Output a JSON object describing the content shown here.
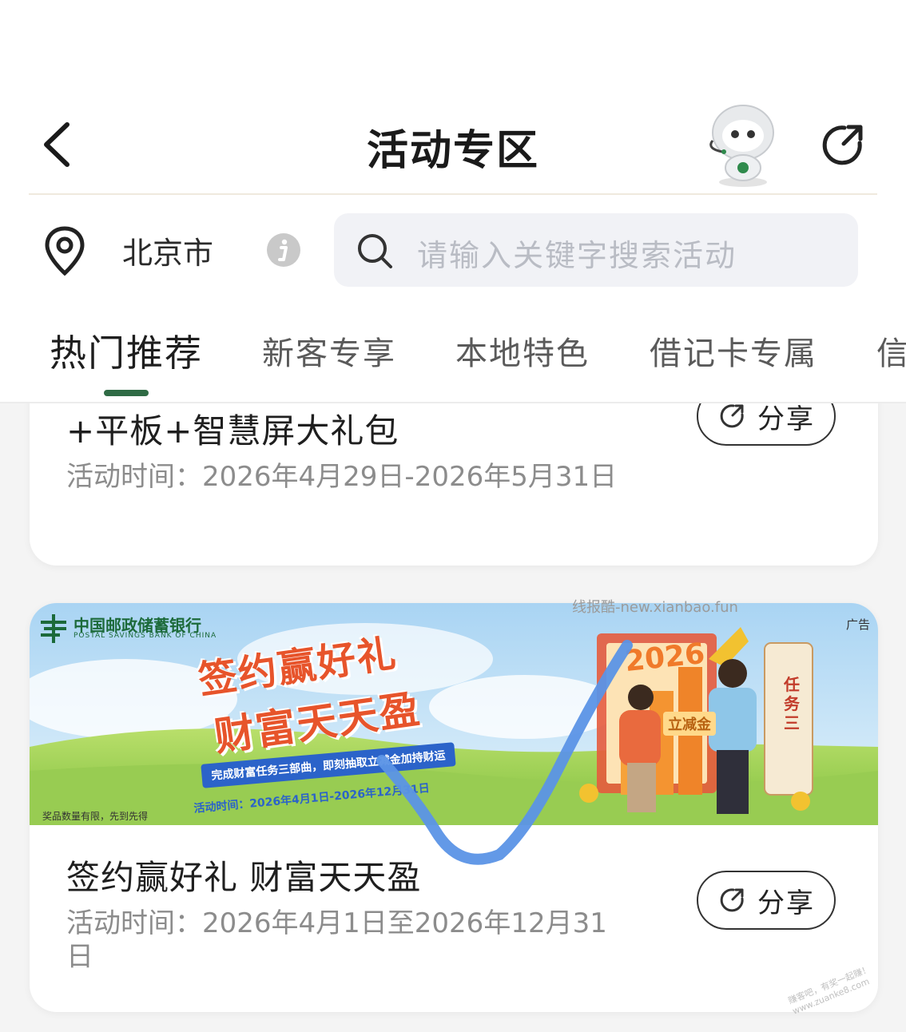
{
  "header": {
    "title": "活动专区",
    "location": "北京市",
    "search_placeholder": "请输入关键字搜索活动"
  },
  "tabs": [
    {
      "label": "热门推荐",
      "active": true
    },
    {
      "label": "新客专享",
      "active": false
    },
    {
      "label": "本地特色",
      "active": false
    },
    {
      "label": "借记卡专属",
      "active": false
    },
    {
      "label": "信",
      "active": false
    }
  ],
  "cards": [
    {
      "title": "+平板+智慧屏大礼包",
      "date": "活动时间：2026年4月29日-2026年5月31日",
      "share_label": "分享"
    },
    {
      "title": "签约赢好礼 财富天天盈",
      "date": "活动时间：2026年4月1日至2026年12月31日",
      "share_label": "分享",
      "banner": {
        "bank_name": "中国邮政储蓄银行",
        "bank_name_en": "POSTAL SAVINGS BANK OF CHINA",
        "ad_label": "广告",
        "headline_1": "签约赢好礼",
        "headline_2": "财富天天盈",
        "ribbon": "完成财富任务三部曲，即刻抽取立减金加持财运",
        "time_text": "活动时间：2026年4月1日-2026年12月31日",
        "footnote": "奖品数量有限，先到先得",
        "year": "2026",
        "gold_label": "立减金",
        "task_label": "任务三"
      }
    }
  ],
  "overlays": {
    "watermark": "线报酷-new.xianbao.fun",
    "corner_watermark_1": "赚客吧，有奖一起赚！",
    "corner_watermark_2": "www.zuanke8.com"
  },
  "colors": {
    "tab_indicator": "#2f6b45",
    "checkmark": "#5b93e6",
    "banner_accent": "#e7542b"
  }
}
